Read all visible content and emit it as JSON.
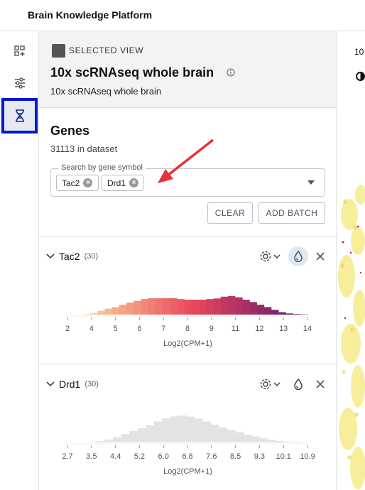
{
  "app": {
    "title": "Brain Knowledge Platform"
  },
  "sidebar_rail": {
    "items": [
      {
        "name": "add-widget",
        "icon": "grid-plus-icon"
      },
      {
        "name": "settings",
        "icon": "sliders-icon"
      },
      {
        "name": "genes",
        "icon": "dna-icon",
        "active": true
      }
    ],
    "active_color": "#0018d6"
  },
  "selected_view": {
    "kicker": "SELECTED VIEW",
    "title": "10x scRNAseq whole brain",
    "subtitle": "10x scRNAseq whole brain",
    "info_icon": "info-icon"
  },
  "genes": {
    "title": "Genes",
    "count_text": "31113 in dataset",
    "search_label": "Search by gene symbol",
    "chips": [
      "Tac2",
      "Drd1"
    ],
    "clear_label": "CLEAR",
    "add_batch_label": "ADD BATCH"
  },
  "gene_cards": [
    {
      "symbol": "Tac2",
      "count": "(30)",
      "colored": true,
      "xlabel": "Log2(CPM+1)",
      "ticks": [
        "2",
        "4",
        "5",
        "6",
        "7",
        "8",
        "9",
        "11",
        "12",
        "13",
        "14"
      ],
      "bars": [
        0.02,
        0.05,
        0.13,
        0.2,
        0.25,
        0.33,
        0.4,
        0.46,
        0.52,
        0.55,
        0.55,
        0.55,
        0.55,
        0.52,
        0.5,
        0.5,
        0.5,
        0.52,
        0.54,
        0.6,
        0.62,
        0.58,
        0.5,
        0.42,
        0.33,
        0.25,
        0.16,
        0.08,
        0.04,
        0.02,
        0.01
      ]
    },
    {
      "symbol": "Drd1",
      "count": "(30)",
      "colored": false,
      "xlabel": "Log2(CPM+1)",
      "ticks": [
        "2.7",
        "3.5",
        "4.4",
        "5.2",
        "6.0",
        "6.8",
        "7.6",
        "8.5",
        "9.3",
        "10.1",
        "10.9"
      ],
      "bars": [
        0.02,
        0.05,
        0.1,
        0.18,
        0.28,
        0.38,
        0.48,
        0.58,
        0.7,
        0.8,
        0.87,
        0.9,
        0.87,
        0.8,
        0.7,
        0.6,
        0.5,
        0.42,
        0.34,
        0.26,
        0.2,
        0.14,
        0.09,
        0.05,
        0.03,
        0.02
      ]
    }
  ],
  "map": {
    "label": "10",
    "contrast_icon": "contrast-icon"
  },
  "colors": {
    "palette_start": "#fbd59a",
    "palette_mid": "#e8445a",
    "palette_end": "#5b1a6e",
    "disabled_bar": "#e3e3e3",
    "annotation_arrow": "#e8303a"
  }
}
